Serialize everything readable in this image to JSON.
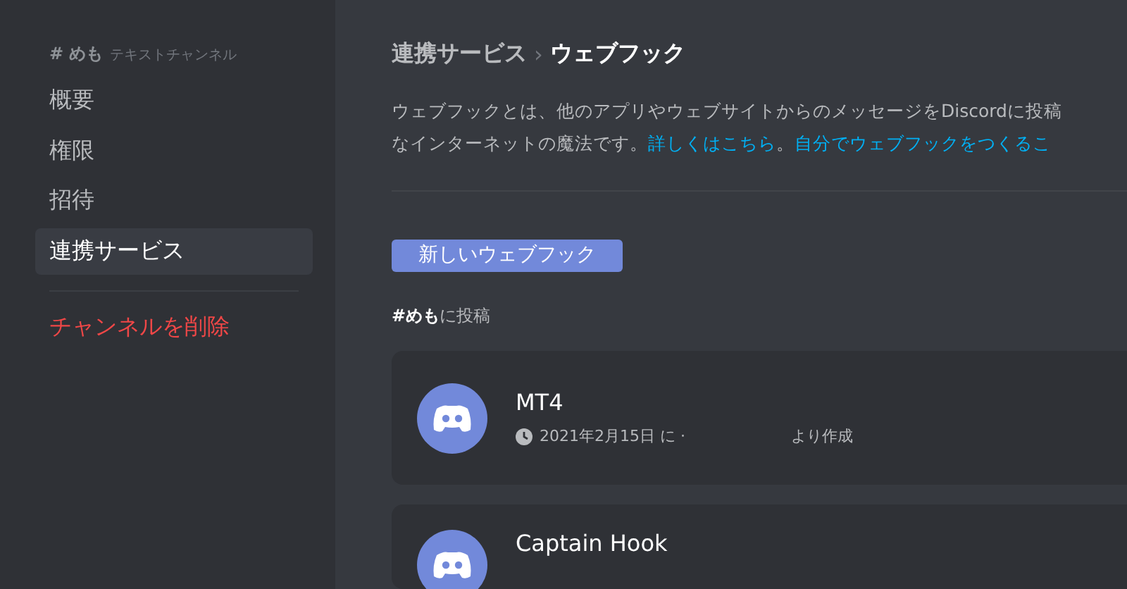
{
  "sidebar": {
    "channel": "# めも",
    "category": "テキストチャンネル",
    "items": [
      {
        "label": "概要",
        "selected": false
      },
      {
        "label": "権限",
        "selected": false
      },
      {
        "label": "招待",
        "selected": false
      },
      {
        "label": "連携サービス",
        "selected": true
      }
    ],
    "danger_item": "チャンネルを削除"
  },
  "breadcrumb": {
    "parent": "連携サービス",
    "separator": "›",
    "current": "ウェブフック"
  },
  "description": {
    "line_1": "ウェブフックとは、他のアプリやウェブサイトからのメッセージをDiscordに投稿",
    "line_2": "なインターネットの魔法です。",
    "link_1": "詳しくはこちら",
    "separator": "。",
    "link_2": "自分でウェブフックをつくるこ"
  },
  "new_button": "新しいウェブフック",
  "post_channel": "**#めも**に投稿",
  "webhooks": [
    {
      "name": "MT4",
      "created": "2021年2月15日 に ·",
      "created_suffix": "より作成"
    },
    {
      "name": "Captain Hook"
    }
  ]
}
